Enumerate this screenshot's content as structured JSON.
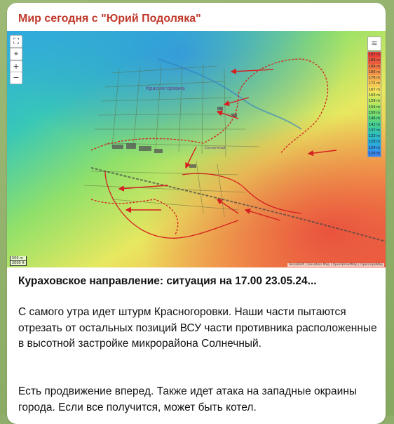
{
  "post": {
    "channel_name": "Мир сегодня с \"Юрий Подоляка\"",
    "title": "Кураховское направление: ситуация на 17.00 23.05.24...",
    "paragraph1": "С самого утра идет штурм Красногоровки. Наши части пытаются отрезать от остальных позиций ВСУ части противника расположенные в высотной застройке микрорайона Солнечный.",
    "paragraph2": "Есть продвижение вперед. Также идет атака на западные окраины города. Если все получится, может быть котел."
  },
  "map": {
    "town_label": "Красногоровка",
    "district_label": "Солнечный",
    "controls": {
      "fullscreen": "⛶",
      "locate": "⌖",
      "zoom_in": "+",
      "zoom_out": "−",
      "layers": "≋"
    },
    "scale": [
      "500 m",
      "2000 ft"
    ],
    "attribution": "TessaDEM | Elevation Map | OpenStreetMap | OpenTopoMap",
    "elevation_legend": [
      {
        "label": "197 m",
        "color": "#e8413a"
      },
      {
        "label": "189 m",
        "color": "#ec5a3e"
      },
      {
        "label": "184 m",
        "color": "#f07844"
      },
      {
        "label": "180 m",
        "color": "#f3944a"
      },
      {
        "label": "176 m",
        "color": "#f6b050"
      },
      {
        "label": "172 m",
        "color": "#f8cb56"
      },
      {
        "label": "167 m",
        "color": "#f4e05a"
      },
      {
        "label": "163 m",
        "color": "#dbe85c"
      },
      {
        "label": "159 m",
        "color": "#bde85e"
      },
      {
        "label": "154 m",
        "color": "#9ae264"
      },
      {
        "label": "150 m",
        "color": "#78dc6e"
      },
      {
        "label": "146 m",
        "color": "#5bd67f"
      },
      {
        "label": "141 m",
        "color": "#45cf95"
      },
      {
        "label": "137 m",
        "color": "#35c7ad"
      },
      {
        "label": "133 m",
        "color": "#2cbcc6"
      },
      {
        "label": "128 m",
        "color": "#2aaed8"
      },
      {
        "label": "124 m",
        "color": "#2f9ce6"
      },
      {
        "label": "120 m",
        "color": "#3a86ef"
      }
    ]
  },
  "colors": {
    "channel_name": "#c0392b",
    "arrows": "#d42020"
  }
}
